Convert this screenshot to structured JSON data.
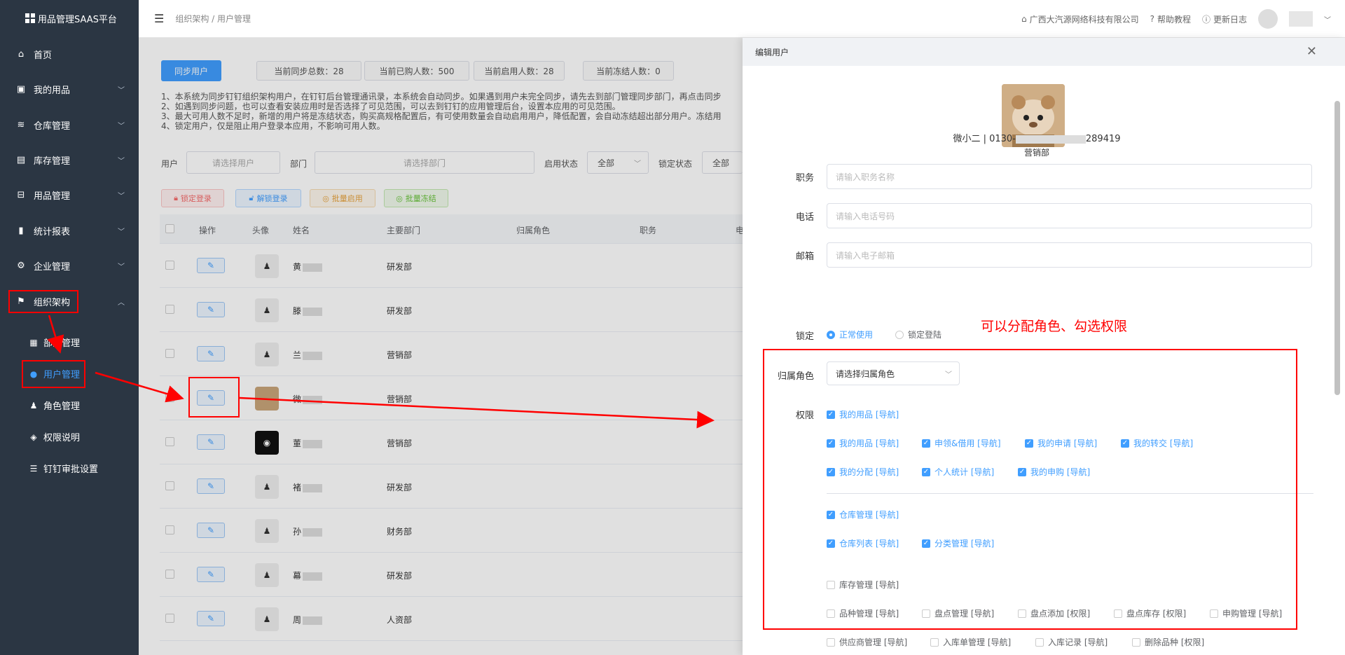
{
  "app": {
    "title": "用品管理SAAS平台"
  },
  "sidebar": {
    "items": [
      {
        "label": "首页",
        "icon": "home-icon"
      },
      {
        "label": "我的用品",
        "icon": "bag-icon"
      },
      {
        "label": "仓库管理",
        "icon": "database-icon"
      },
      {
        "label": "库存管理",
        "icon": "box-icon"
      },
      {
        "label": "用品管理",
        "icon": "drive-icon"
      },
      {
        "label": "统计报表",
        "icon": "bar-chart-icon"
      },
      {
        "label": "企业管理",
        "icon": "gear-icon"
      },
      {
        "label": "组织架构",
        "icon": "flag-icon"
      }
    ],
    "sub_items": [
      {
        "label": "部门管理",
        "icon": "grid-icon"
      },
      {
        "label": "用户管理",
        "icon": "user-icon"
      },
      {
        "label": "角色管理",
        "icon": "person-icon"
      },
      {
        "label": "权限说明",
        "icon": "shield-icon"
      },
      {
        "label": "钉钉审批设置",
        "icon": "sliders-icon"
      }
    ]
  },
  "header": {
    "breadcrumb": "组织架构 / 用户管理",
    "company": "广西大汽源网络科技有限公司",
    "help": "帮助教程",
    "changelog": "更新日志"
  },
  "main": {
    "sync_button": "同步用户",
    "stats": [
      "当前同步总数：28",
      "当前已购人数：500",
      "当前启用人数：28",
      "当前冻结人数：0"
    ],
    "notes": [
      "1、本系统为同步钉钉组织架构用户，在钉钉后台管理通讯录，本系统会自动同步。如果遇到用户未完全同步，请先去到部门管理同步部门，再点击同步",
      "2、如遇到同步问题，也可以查看安装应用时是否选择了可见范围，可以去到钉钉的应用管理后台，设置本应用的可见范围。",
      "3、最大可用人数不足时，新增的用户将是冻结状态，购买高规格配置后，有可使用数量会自动启用用户，降低配置，会自动冻结超出部分用户。冻结用",
      "4、锁定用户，仅是阻止用户登录本应用，不影响可用人数。"
    ],
    "filters": {
      "user_label": "用户",
      "user_placeholder": "请选择用户",
      "dept_label": "部门",
      "dept_placeholder": "请选择部门",
      "enable_label": "启用状态",
      "enable_value": "全部",
      "lock_label": "锁定状态",
      "lock_value": "全部"
    },
    "actions": [
      "锁定登录",
      "解锁登录",
      "批量启用",
      "批量冻结"
    ],
    "table": {
      "headers": [
        "操作",
        "头像",
        "姓名",
        "主要部门",
        "归属角色",
        "职务",
        "电"
      ],
      "rows": [
        {
          "name": "黄",
          "dept": "研发部"
        },
        {
          "name": "滕",
          "dept": "研发部"
        },
        {
          "name": "兰",
          "dept": "营销部"
        },
        {
          "name": "微",
          "dept": "营销部"
        },
        {
          "name": "董",
          "dept": "营销部"
        },
        {
          "name": "褚",
          "dept": "研发部"
        },
        {
          "name": "孙",
          "dept": "财务部"
        },
        {
          "name": "幕",
          "dept": "研发部"
        },
        {
          "name": "周",
          "dept": "人资部"
        }
      ]
    }
  },
  "drawer": {
    "title": "编辑用户",
    "user_name": "微小二 | 0130-",
    "user_phone_suffix": "289419",
    "user_dept": "营销部",
    "fields": [
      {
        "label": "职务",
        "placeholder": "请输入职务名称"
      },
      {
        "label": "电话",
        "placeholder": "请输入电话号码"
      },
      {
        "label": "邮箱",
        "placeholder": "请输入电子邮箱"
      }
    ],
    "lock_label": "锁定",
    "lock_options": [
      "正常使用",
      "锁定登陆"
    ],
    "annotation": "可以分配角色、勾选权限",
    "role_label": "归属角色",
    "role_placeholder": "请选择归属角色",
    "perm_label": "权限",
    "perms": {
      "group1_root": "我的用品 [导航]",
      "group1": [
        "我的用品 [导航]",
        "申领&借用 [导航]",
        "我的申请 [导航]",
        "我的转交 [导航]",
        "我的分配 [导航]",
        "个人统计 [导航]",
        "我的申购 [导航]"
      ],
      "group2_root": "仓库管理 [导航]",
      "group2": [
        "仓库列表 [导航]",
        "分类管理 [导航]"
      ],
      "group3_root": "库存管理 [导航]",
      "group3": [
        "品种管理 [导航]",
        "盘点管理 [导航]",
        "盘点添加 [权限]",
        "盘点库存 [权限]",
        "申购管理 [导航]",
        "供应商管理 [导航]",
        "入库单管理 [导航]",
        "入库记录 [导航]",
        "删除品种 [权限]"
      ]
    }
  }
}
